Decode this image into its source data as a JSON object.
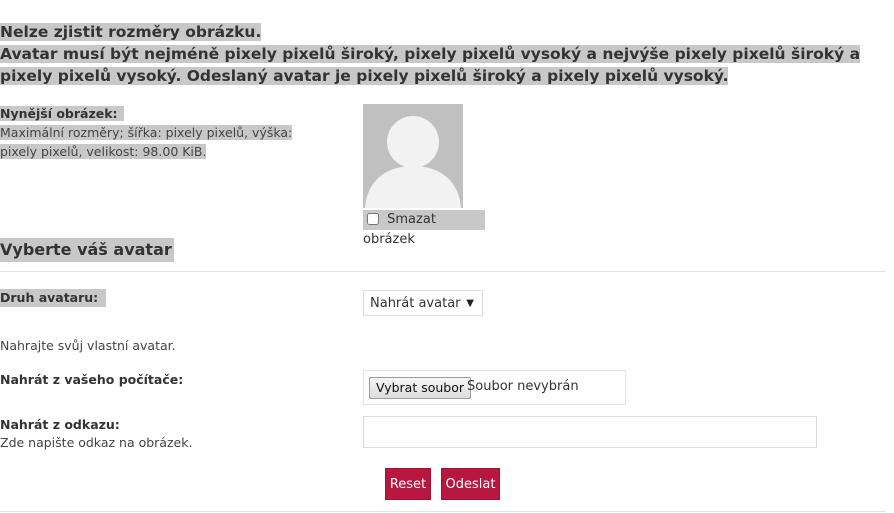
{
  "error": {
    "line1": "Nelze zjistit rozměry obrázku.",
    "line2": "Avatar musí být nejméně pixely pixelů široký, pixely pixelů vysoký a nejvýše pixely pixelů široký a pixely pixelů vysoký. Odeslaný avatar je pixely pixelů široký a pixely pixelů vysoký."
  },
  "current": {
    "label": "Nynější obrázek:",
    "description": "Maximální rozměry; šířka: pixely pixelů, výška: pixely pixelů, velikost: 98.00 KiB.",
    "delete_label": "Smazat obrázek",
    "delete_checked": false
  },
  "section": {
    "title": "Vyberte váš avatar"
  },
  "avatar_type": {
    "label": "Druh avataru:",
    "selected": "Nahrát avatar"
  },
  "upload": {
    "hint": "Nahrajte svůj vlastní avatar.",
    "label": "Nahrát z vašeho počítače:",
    "button_label": "Vybrat soubor",
    "status": "Soubor nevybrán"
  },
  "link": {
    "label": "Nahrát z odkazu:",
    "hint": "Zde napište odkaz na obrázek.",
    "value": ""
  },
  "buttons": {
    "reset": "Reset",
    "submit": "Odeslat"
  },
  "colors": {
    "accent": "#b7173f",
    "highlight": "#c8c8c8",
    "avatar_bg": "#c0c0c0"
  }
}
